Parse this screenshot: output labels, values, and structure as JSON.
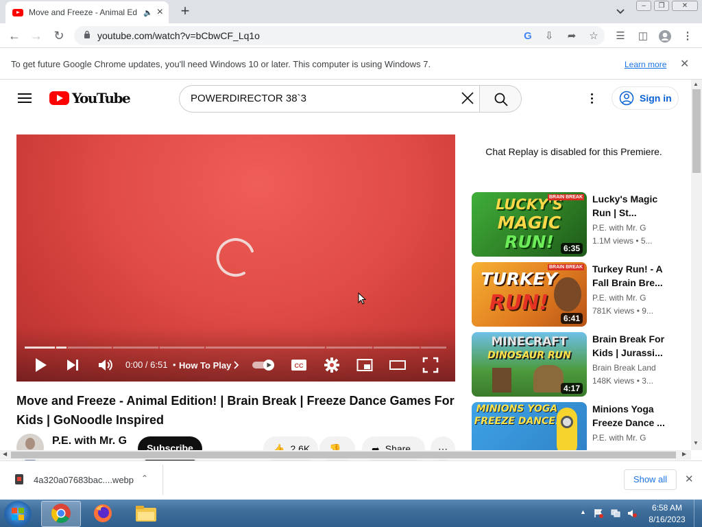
{
  "browser": {
    "tab_title": "Move and Freeze - Animal Ed",
    "tab_audio_icon": "speaker-icon",
    "new_tab_label": "+",
    "url": "youtube.com/watch?v=bCbwCF_Lq1o"
  },
  "infobar": {
    "message": "To get future Google Chrome updates, you'll need Windows 10 or later. This computer is using Windows 7.",
    "learn_more": "Learn more"
  },
  "youtube": {
    "logo_text": "YouTube",
    "search_value": "POWERDIRECTOR 38`3",
    "signin_label": "Sign in"
  },
  "player": {
    "time": "0:00 / 6:51",
    "chapter": "How To Play",
    "progress_loaded_fraction": 0.1
  },
  "video": {
    "title": "Move and Freeze - Animal Edition! | Brain Break | Freeze Dance Games For Kids | GoNoodle Inspired",
    "channel": "P.E. with Mr. G",
    "subscribe_label": "Subscribe",
    "likes": "2.6K",
    "share_label": "Share"
  },
  "sidebar": {
    "chat_note": "Chat Replay is disabled for this Premiere.",
    "recommendations": [
      {
        "title": "Lucky's Magic Run | St...",
        "channel": "P.E. with Mr. G",
        "meta": "1.1M views  • 5...",
        "duration": "6:35",
        "thumb_text": [
          "LUCKY'S",
          "MAGIC",
          "RUN!"
        ],
        "badge": "BRAIN BREAK"
      },
      {
        "title": "Turkey Run! - A Fall Brain Bre...",
        "channel": "P.E. with Mr. G",
        "meta": "781K views  • 9...",
        "duration": "6:41",
        "thumb_text": [
          "TURKEY",
          "RUN!"
        ],
        "badge": "BRAIN BREAK"
      },
      {
        "title": "Brain Break For Kids | Jurassi...",
        "channel": "Brain Break Land",
        "meta": "148K views  • 3...",
        "duration": "4:17",
        "thumb_text": [
          "MINECRAFT",
          "DINOSAUR RUN"
        ]
      },
      {
        "title": "Minions Yoga Freeze Dance ...",
        "channel": "P.E. with Mr. G",
        "meta": "",
        "duration": "",
        "thumb_text": [
          "MINIONS YOGA",
          "FREEZE DANCE!"
        ]
      }
    ]
  },
  "downloads": {
    "file_name": "4a320a07683bac....webp",
    "show_all": "Show all"
  },
  "taskbar": {
    "time": "6:58 AM",
    "date": "8/16/2023",
    "apps": [
      "chrome-icon",
      "firefox-icon",
      "file-explorer-icon"
    ]
  }
}
